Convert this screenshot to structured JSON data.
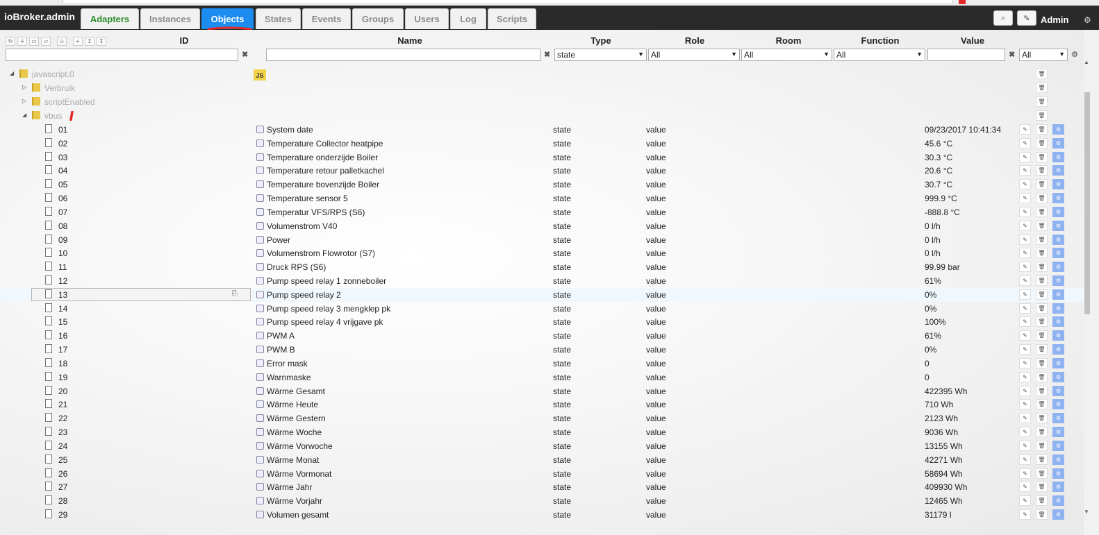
{
  "app": {
    "title": "ioBroker.admin",
    "user": "Admin"
  },
  "tabs": [
    {
      "label": "Adapters"
    },
    {
      "label": "Instances"
    },
    {
      "label": "Objects"
    },
    {
      "label": "States"
    },
    {
      "label": "Events"
    },
    {
      "label": "Groups"
    },
    {
      "label": "Users"
    },
    {
      "label": "Log"
    },
    {
      "label": "Scripts"
    }
  ],
  "columns": {
    "id": "ID",
    "name": "Name",
    "type": "Type",
    "role": "Role",
    "room": "Room",
    "function": "Function",
    "value": "Value"
  },
  "filters": {
    "type": "state",
    "role": "All",
    "room": "All",
    "function": "All",
    "value_sel": "All"
  },
  "tree": [
    {
      "label": "javascript.0"
    },
    {
      "label": "Verbruik"
    },
    {
      "label": "scriptEnabled"
    },
    {
      "label": "vbus"
    }
  ],
  "js_badge": "JS",
  "rows": [
    {
      "id": "01",
      "name": "System date",
      "type": "state",
      "role": "value",
      "value": "09/23/2017 10:41:34"
    },
    {
      "id": "02",
      "name": "Temperature Collector heatpipe",
      "type": "state",
      "role": "value",
      "value": "45.6 °C"
    },
    {
      "id": "03",
      "name": "Temperature onderzijde Boiler",
      "type": "state",
      "role": "value",
      "value": "30.3 °C"
    },
    {
      "id": "04",
      "name": "Temperature retour palletkachel",
      "type": "state",
      "role": "value",
      "value": "20.6 °C"
    },
    {
      "id": "05",
      "name": "Temperature bovenzijde Boiler",
      "type": "state",
      "role": "value",
      "value": "30.7 °C"
    },
    {
      "id": "06",
      "name": "Temperature sensor 5",
      "type": "state",
      "role": "value",
      "value": "999.9 °C"
    },
    {
      "id": "07",
      "name": "Temperatur VFS/RPS (S6)",
      "type": "state",
      "role": "value",
      "value": "-888.8 °C"
    },
    {
      "id": "08",
      "name": "Volumenstrom V40",
      "type": "state",
      "role": "value",
      "value": "0 l/h"
    },
    {
      "id": "09",
      "name": "Power",
      "type": "state",
      "role": "value",
      "value": "0 l/h"
    },
    {
      "id": "10",
      "name": "Volumenstrom Flowrotor (S7)",
      "type": "state",
      "role": "value",
      "value": "0 l/h"
    },
    {
      "id": "11",
      "name": "Druck RPS (S6)",
      "type": "state",
      "role": "value",
      "value": "99.99 bar"
    },
    {
      "id": "12",
      "name": "Pump speed relay 1 zonneboiler",
      "type": "state",
      "role": "value",
      "value": "61%"
    },
    {
      "id": "13",
      "name": "Pump speed relay 2",
      "type": "state",
      "role": "value",
      "value": "0%"
    },
    {
      "id": "14",
      "name": "Pump speed relay 3 mengklep pk",
      "type": "state",
      "role": "value",
      "value": "0%"
    },
    {
      "id": "15",
      "name": "Pump speed relay 4 vrijgave pk",
      "type": "state",
      "role": "value",
      "value": "100%"
    },
    {
      "id": "16",
      "name": "PWM A",
      "type": "state",
      "role": "value",
      "value": "61%"
    },
    {
      "id": "17",
      "name": "PWM B",
      "type": "state",
      "role": "value",
      "value": "0%"
    },
    {
      "id": "18",
      "name": "Error mask",
      "type": "state",
      "role": "value",
      "value": "0"
    },
    {
      "id": "19",
      "name": "Warnmaske",
      "type": "state",
      "role": "value",
      "value": "0"
    },
    {
      "id": "20",
      "name": "Wärme Gesamt",
      "type": "state",
      "role": "value",
      "value": "422395 Wh"
    },
    {
      "id": "21",
      "name": "Wärme Heute",
      "type": "state",
      "role": "value",
      "value": "710 Wh"
    },
    {
      "id": "22",
      "name": "Wärme Gestern",
      "type": "state",
      "role": "value",
      "value": "2123 Wh"
    },
    {
      "id": "23",
      "name": "Wärme Woche",
      "type": "state",
      "role": "value",
      "value": "9036 Wh"
    },
    {
      "id": "24",
      "name": "Wärme Vorwoche",
      "type": "state",
      "role": "value",
      "value": "13155 Wh"
    },
    {
      "id": "25",
      "name": "Wärme Monat",
      "type": "state",
      "role": "value",
      "value": "42271 Wh"
    },
    {
      "id": "26",
      "name": "Wärme Vormonat",
      "type": "state",
      "role": "value",
      "value": "58694 Wh"
    },
    {
      "id": "27",
      "name": "Wärme Jahr",
      "type": "state",
      "role": "value",
      "value": "409930 Wh"
    },
    {
      "id": "28",
      "name": "Wärme Vorjahr",
      "type": "state",
      "role": "value",
      "value": "12465 Wh"
    },
    {
      "id": "29",
      "name": "Volumen gesamt",
      "type": "state",
      "role": "value",
      "value": "31179 l"
    }
  ],
  "colors": {
    "header_bg": "#2a2a2a",
    "active_tab": "#1d8cf0",
    "adapters_tab": "#2a8c2a",
    "annotation": "#e52727"
  }
}
